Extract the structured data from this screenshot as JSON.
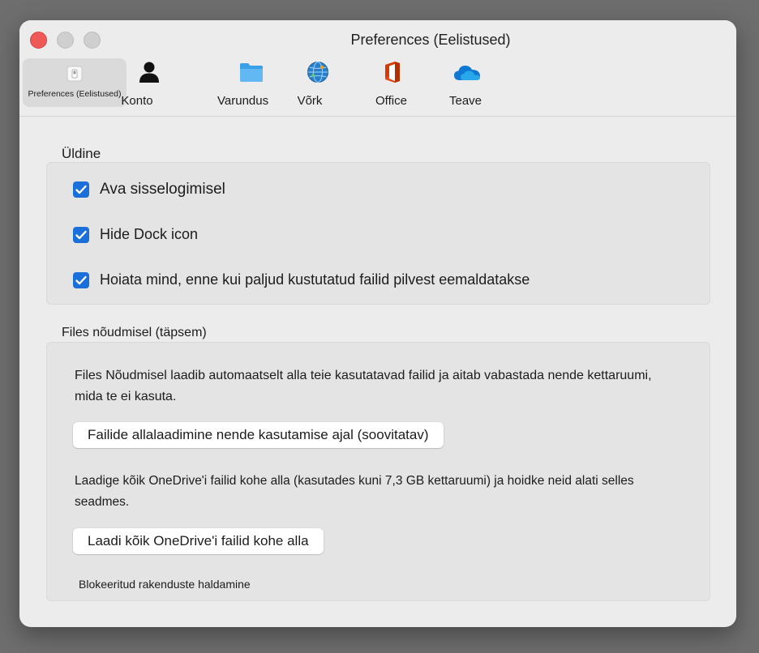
{
  "window": {
    "title": "Preferences (Eelistused)"
  },
  "tabs": [
    {
      "label": "Preferences (Eelistused)",
      "icon": "switch-icon",
      "selected": true
    },
    {
      "label": "Konto",
      "icon": "person-icon"
    },
    {
      "label": "Varundus",
      "icon": "folder-icon"
    },
    {
      "label": "Võrk",
      "icon": "globe-icon"
    },
    {
      "label": "Office",
      "icon": "office-icon"
    },
    {
      "label": "Teave",
      "icon": "onedrive-cloud-icon"
    }
  ],
  "general": {
    "title": "Üldine",
    "options": [
      {
        "label": "Ava sisselogimisel",
        "checked": true
      },
      {
        "label": "Hide Dock icon",
        "checked": true
      },
      {
        "label": "Hoiata mind, enne kui paljud kustutatud failid pilvest eemaldatakse",
        "checked": true
      }
    ]
  },
  "files_on_demand": {
    "title": "Files nõudmisel (täpsem)",
    "description": "Files Nõudmisel laadib automaatselt alla teie kasutatavad failid ja aitab vabastada nende kettaruumi, mida te ei kasuta.",
    "download_on_use_button": "Failide allalaadimine nende kasutamise ajal (soovitatav)",
    "download_all_description": "Laadige kõik OneDrive'i failid kohe alla (kasutades kuni 7,3 GB kettaruumi) ja hoidke neid alati selles seadmes.",
    "download_all_button": "Laadi kõik OneDrive'i failid kohe alla",
    "blocked_apps_link": "Blokeeritud rakenduste haldamine"
  },
  "colors": {
    "accent": "#1b6fd8",
    "close_button": "#ee5b57",
    "office_red": "#d83b01",
    "onedrive_blue": "#0f78d4"
  }
}
